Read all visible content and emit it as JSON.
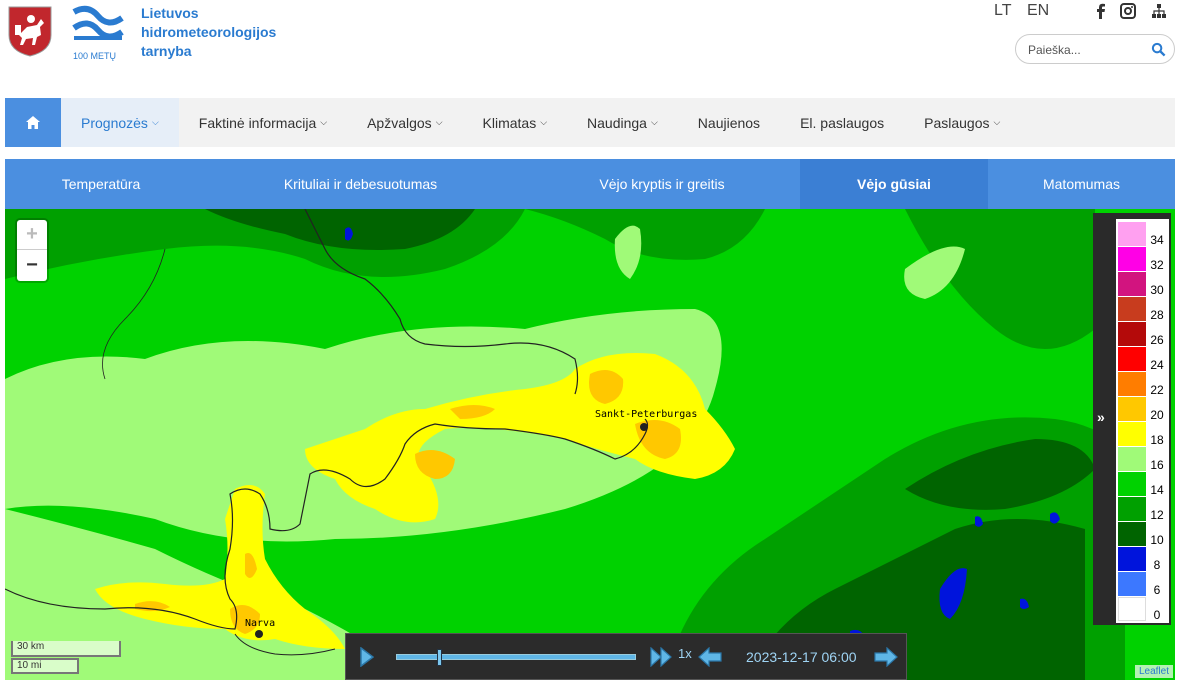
{
  "header": {
    "org_name_lines": [
      "Lietuvos",
      "hidrometeorologijos",
      "tarnyba"
    ],
    "logo_caption": "100 METŲ",
    "lang_lt": "LT",
    "lang_en": "EN",
    "social_icons": [
      "facebook-icon",
      "instagram-icon",
      "sitemap-icon"
    ],
    "search_placeholder": "Paieška..."
  },
  "main_nav": {
    "items": [
      {
        "label": "Prognozės",
        "dropdown": true,
        "active": true
      },
      {
        "label": "Faktinė informacija",
        "dropdown": true
      },
      {
        "label": "Apžvalgos",
        "dropdown": true
      },
      {
        "label": "Klimatas",
        "dropdown": true
      },
      {
        "label": "Naudinga",
        "dropdown": true
      },
      {
        "label": "Naujienos",
        "dropdown": false
      },
      {
        "label": "El. paslaugos",
        "dropdown": false
      },
      {
        "label": "Paslaugos",
        "dropdown": true
      }
    ]
  },
  "sub_nav": {
    "tabs": [
      {
        "label": "Temperatūra"
      },
      {
        "label": "Krituliai ir debesuotumas"
      },
      {
        "label": "Vėjo kryptis ir greitis"
      },
      {
        "label": "Vėjo gūsiai",
        "active": true
      },
      {
        "label": "Matomumas"
      }
    ]
  },
  "map": {
    "cities": [
      "Sankt-Peterburgas",
      "Narva"
    ],
    "scale_km": "30 km",
    "scale_mi": "10 mi",
    "attribution": "Leaflet",
    "zoom_in": "+",
    "zoom_out": "−",
    "legend": [
      {
        "value": "34",
        "color": "#ffa0f0"
      },
      {
        "value": "32",
        "color": "#ff00e6"
      },
      {
        "value": "30",
        "color": "#d2147f"
      },
      {
        "value": "28",
        "color": "#c83c1e"
      },
      {
        "value": "26",
        "color": "#b40a0a"
      },
      {
        "value": "24",
        "color": "#ff0000"
      },
      {
        "value": "22",
        "color": "#ff7d00"
      },
      {
        "value": "20",
        "color": "#ffc800"
      },
      {
        "value": "18",
        "color": "#ffff00"
      },
      {
        "value": "16",
        "color": "#a0fa78"
      },
      {
        "value": "14",
        "color": "#00d200"
      },
      {
        "value": "12",
        "color": "#00a000"
      },
      {
        "value": "10",
        "color": "#006400"
      },
      {
        "value": "8",
        "color": "#0014dc"
      },
      {
        "value": "6",
        "color": "#3c78ff"
      },
      {
        "value": "0",
        "color": "#ffffff"
      }
    ]
  },
  "player": {
    "speed": "1x",
    "time": "2023-12-17 06:00",
    "progress": 0.17
  }
}
